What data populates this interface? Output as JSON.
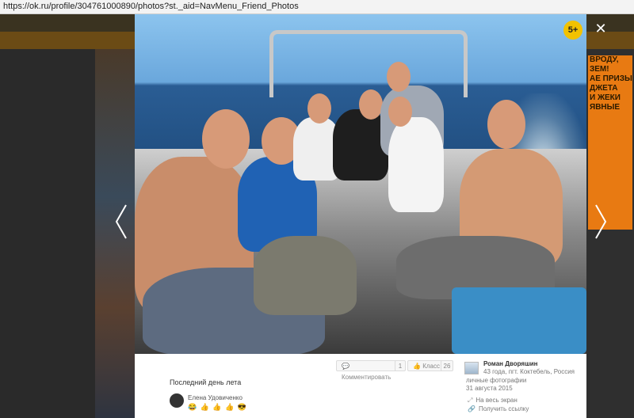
{
  "browser": {
    "url": "https://ok.ru/profile/304761000890/photos?st._aid=NavMenu_Friend_Photos"
  },
  "background_ad": {
    "lines": [
      "ВРОДУ,",
      "ЗЕМ!",
      "АЕ ПРИЗЫ",
      "ДЖЕТА",
      "И ЖЕКИ",
      "ЯВНЫЕ"
    ]
  },
  "viewer": {
    "age_badge": "5+",
    "close_icon": "close-icon",
    "prev_icon": "chevron-left-icon",
    "next_icon": "chevron-right-icon"
  },
  "photo_info": {
    "comment_label": "Комментировать",
    "comment_count": "1",
    "like_label": "Класс",
    "like_count": "26",
    "caption": "Последний день лета",
    "commenter_name": "Елена Удовиченко",
    "commenter_emojis": "😂 👍 👍 👍 😎",
    "author_name": "Роман Дворяшин",
    "author_info": "43 года, пгт. Коктебель, Россия",
    "album": "личные фотографии",
    "date": "31 августа 2015",
    "fullscreen_label": "На весь экран",
    "link_label": "Получить ссылку"
  }
}
